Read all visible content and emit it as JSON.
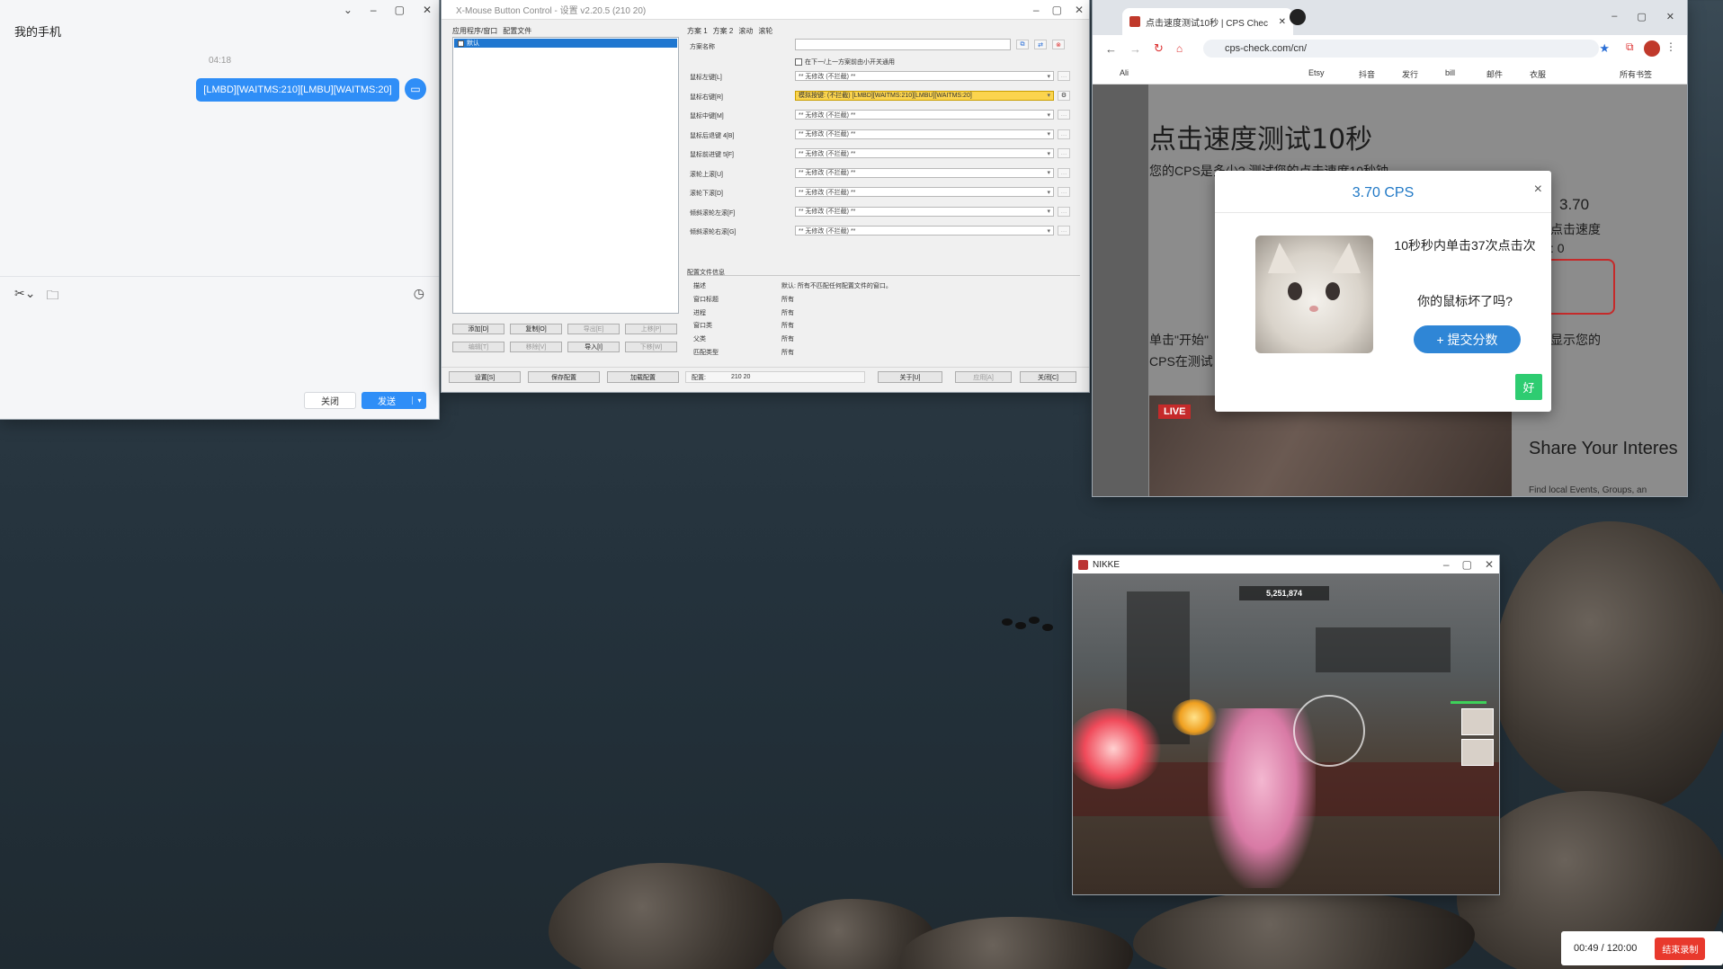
{
  "phone_window": {
    "title": "我的手机",
    "time": "04:18",
    "message": "[LMBD][WAITMS:210][LMBU][WAITMS:20]",
    "close_label": "关闭",
    "send_label": "发送"
  },
  "xmbc": {
    "title": "X-Mouse Button Control - 设置 v2.20.5 (210 20)",
    "left_tabs": [
      "应用程序/窗口",
      "配置文件"
    ],
    "list_selected": "默认",
    "right_tabs": [
      "方案 1",
      "方案 2",
      "滚动",
      "滚轮"
    ],
    "scheme_name_label": "方案名称",
    "checkbox_label": "在下一/上一方案前由小开关通用",
    "rows": [
      {
        "label": "鼠标左键[L]",
        "value": "** 无修改 (不拦截) **"
      },
      {
        "label": "鼠标右键[R]",
        "value": "模拟按键: (不拦截) [LMBD][WAITMS:210][LMBU][WAITMS:20]"
      },
      {
        "label": "鼠标中键[M]",
        "value": "** 无修改 (不拦截) **"
      },
      {
        "label": "鼠标后退键 4[B]",
        "value": "** 无修改 (不拦截) **"
      },
      {
        "label": "鼠标前进键 5[F]",
        "value": "** 无修改 (不拦截) **"
      },
      {
        "label": "滚轮上滚[U]",
        "value": "** 无修改 (不拦截) **"
      },
      {
        "label": "滚轮下滚[D]",
        "value": "** 无修改 (不拦截) **"
      },
      {
        "label": "倾斜滚轮左滚[F]",
        "value": "** 无修改 (不拦截) **"
      },
      {
        "label": "倾斜滚轮右滚[G]",
        "value": "** 无修改 (不拦截) **"
      }
    ],
    "profile_info_title": "配置文件信息",
    "info": [
      {
        "k": "描述",
        "v": "默认: 所有不匹配任何配置文件的窗口。"
      },
      {
        "k": "窗口标题",
        "v": "所有"
      },
      {
        "k": "进程",
        "v": "所有"
      },
      {
        "k": "窗口类",
        "v": "所有"
      },
      {
        "k": "父类",
        "v": "所有"
      },
      {
        "k": "匹配类型",
        "v": "所有"
      }
    ],
    "list_buttons": [
      "添加[D]",
      "复制[O]",
      "导出[E]",
      "上移[P]",
      "编辑[T]",
      "移除[V]",
      "导入[I]",
      "下移[W]"
    ],
    "bottom": {
      "settings": "设置[S]",
      "save": "保存配置",
      "load": "加载配置",
      "config_label": "配置:",
      "config_value": "210 20",
      "about": "关于[U]",
      "apply": "应用[A]",
      "close": "关闭[C]"
    }
  },
  "chrome": {
    "tab_title": "点击速度测试10秒 | CPS Chec",
    "url": "cps-check.com/cn/",
    "bookmarks": [
      "Ali",
      "Etsy",
      "抖音",
      "发行",
      "bill",
      "邮件",
      "衣服",
      "所有书签"
    ],
    "page_title": "点击速度测试10秒",
    "page_sub": "您的CPS是多少? 测试您的点击速度10秒钟",
    "side_value": "3.70",
    "side_label": "点击速度",
    "side_zero": ": 0",
    "body_left1": "单击\"开始\"",
    "body_left2": "CPS在测试",
    "body_right": "显示您的",
    "live": "LIVE",
    "share_title": "Share Your Interes",
    "share_sub": "Find local Events, Groups, an"
  },
  "modal": {
    "title": "3.70 CPS",
    "line1": "10秒秒内单击37次点击次",
    "line2": "你的鼠标坏了吗?",
    "submit": "+ 提交分数",
    "ok": "好"
  },
  "nikke": {
    "title": "NIKKE",
    "score": "5,251,874"
  },
  "recorder": {
    "time": "00:49 / 120:00",
    "stop": "结束录制"
  }
}
